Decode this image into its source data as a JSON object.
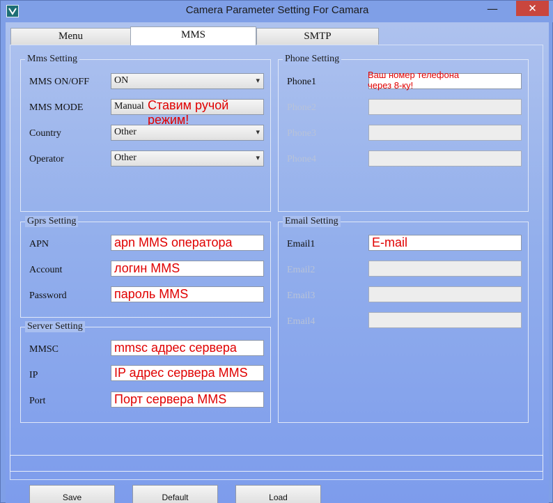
{
  "window": {
    "title": "Camera Parameter Setting For  Camara",
    "min_glyph": "—",
    "max_glyph": "☐",
    "close_glyph": "✕"
  },
  "tabs": [
    {
      "label": "Menu",
      "active": false
    },
    {
      "label": "MMS",
      "active": true
    },
    {
      "label": "SMTP",
      "active": false
    }
  ],
  "mms_setting": {
    "title": "Mms Setting",
    "mms_onoff": {
      "label": "MMS ON/OFF",
      "value": "ON"
    },
    "mms_mode": {
      "label": "MMS MODE",
      "value": "Manual",
      "note": "Ставим ручой режим!"
    },
    "country": {
      "label": "Country",
      "value": "Other"
    },
    "operator": {
      "label": "Operator",
      "value": "Other"
    }
  },
  "phone_setting": {
    "title": "Phone Setting",
    "phone1": {
      "label": "Phone1",
      "note_line1": "Ваш номер телефона",
      "note_line2": "через 8-ку!"
    },
    "phone2": {
      "label": "Phone2"
    },
    "phone3": {
      "label": "Phone3"
    },
    "phone4": {
      "label": "Phone4"
    }
  },
  "gprs_setting": {
    "title": "Gprs Setting",
    "apn": {
      "label": "APN",
      "value": "apn MMS оператора"
    },
    "account": {
      "label": "Account",
      "value": "логин MMS"
    },
    "password": {
      "label": "Password",
      "value": "пароль MMS"
    }
  },
  "email_setting": {
    "title": "Email Setting",
    "email1": {
      "label": "Email1",
      "value": "E-mail"
    },
    "email2": {
      "label": "Email2"
    },
    "email3": {
      "label": "Email3"
    },
    "email4": {
      "label": "Email4"
    }
  },
  "server_setting": {
    "title": "Server Setting",
    "mmsc": {
      "label": "MMSC",
      "value": "mmsc адрес сервера"
    },
    "ip": {
      "label": "IP",
      "value": "IP адрес сервера MMS"
    },
    "port": {
      "label": "Port",
      "value": "Порт сервера MMS"
    }
  },
  "buttons": {
    "save": "Save",
    "default": "Default",
    "load": "Load"
  },
  "colors": {
    "annotation": "#e00000",
    "background": "#7f9fe7",
    "close_button": "#c9463d"
  }
}
